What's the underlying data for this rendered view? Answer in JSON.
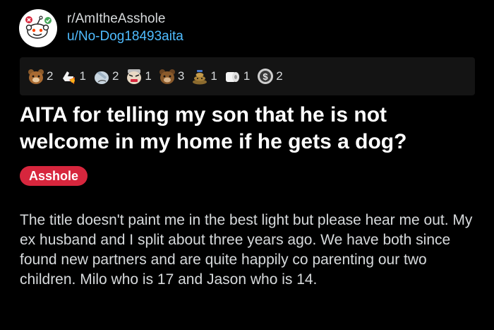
{
  "post": {
    "subreddit": "r/AmItheAsshole",
    "username": "u/No-Dog18493aita",
    "title": "AITA for telling my son that he is not welcome in my home if he gets a dog?",
    "flair": "Asshole",
    "body": "The title doesn't paint me in the best light but please hear me out. My ex husband and I split about three years ago. We have both since found new partners and are quite happily co parenting our two children. Milo who is 17 and Jason who is 14."
  },
  "awards": [
    {
      "icon": "bear-award-icon",
      "count": "2"
    },
    {
      "icon": "rocket-like-award-icon",
      "count": "1"
    },
    {
      "icon": "facepalm-award-icon",
      "count": "2"
    },
    {
      "icon": "angry-face-award-icon",
      "count": "1"
    },
    {
      "icon": "sad-bear-award-icon",
      "count": "3"
    },
    {
      "icon": "poop-award-icon",
      "count": "1"
    },
    {
      "icon": "toilet-paper-award-icon",
      "count": "1"
    },
    {
      "icon": "dollar-badge-award-icon",
      "count": "2"
    }
  ],
  "colors": {
    "background": "#000000",
    "text": "#d7dadc",
    "link": "#4fbcff",
    "flair": "#d7263d",
    "awards_bar": "#141414"
  }
}
